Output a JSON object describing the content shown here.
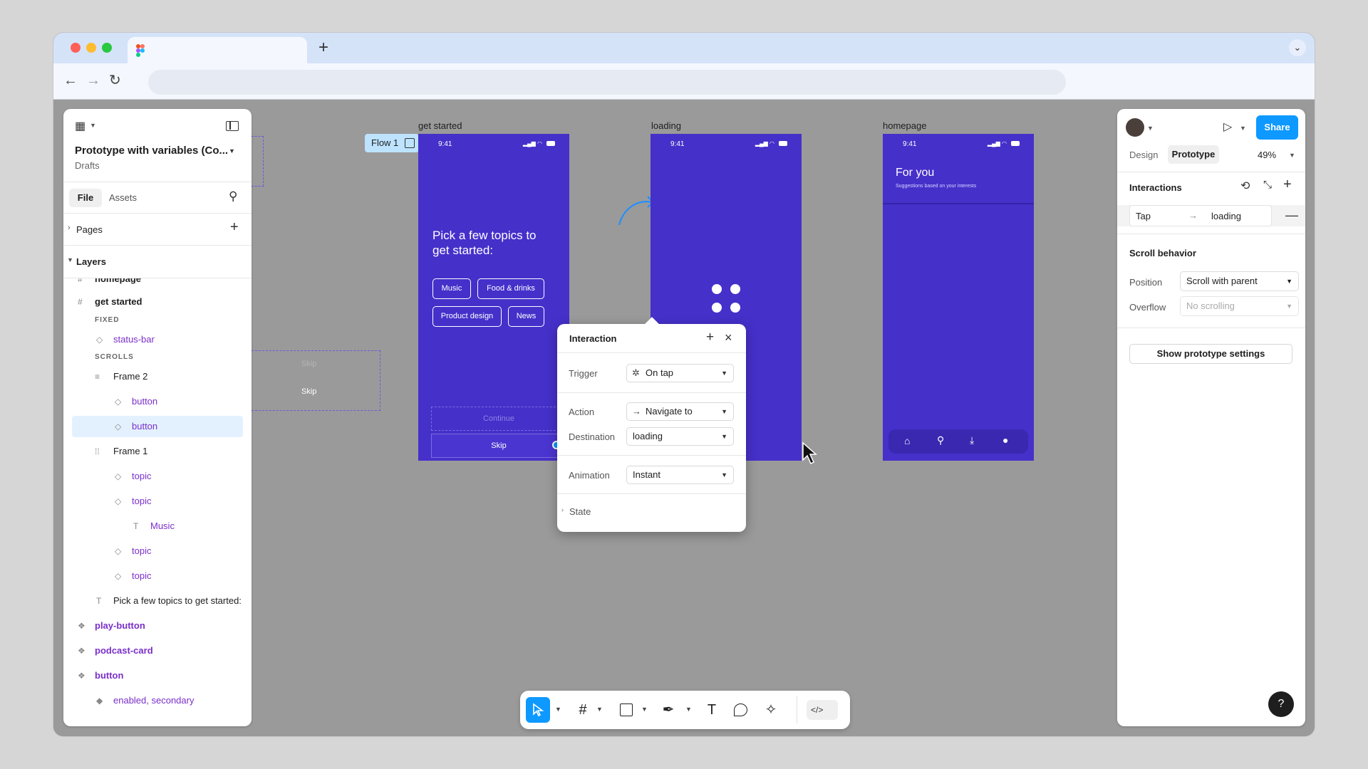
{
  "browser": {
    "new_tab": "+",
    "tab_menu": "⌄"
  },
  "left_panel": {
    "file_title": "Prototype with variables (Co...",
    "subtitle": "Drafts",
    "tabs": {
      "file": "File",
      "assets": "Assets"
    },
    "pages_label": "Pages",
    "layers_label": "Layers",
    "layers": [
      {
        "label": "homepage"
      },
      {
        "label": "get started"
      },
      {
        "label": "FIXED"
      },
      {
        "label": "status-bar"
      },
      {
        "label": "SCROLLS"
      },
      {
        "label": "Frame 2"
      },
      {
        "label": "button"
      },
      {
        "label": "button"
      },
      {
        "label": "Frame 1"
      },
      {
        "label": "topic"
      },
      {
        "label": "topic"
      },
      {
        "label": "Music"
      },
      {
        "label": "topic"
      },
      {
        "label": "topic"
      },
      {
        "label": "Pick a few topics to get started:"
      },
      {
        "label": "play-button"
      },
      {
        "label": "podcast-card"
      },
      {
        "label": "button"
      },
      {
        "label": "enabled, secondary"
      }
    ]
  },
  "canvas": {
    "flow_label": "Flow 1",
    "ghost_skip_1": "Skip",
    "ghost_skip_2": "Skip",
    "frames": {
      "get_started": {
        "name": "get started",
        "time": "9:41",
        "headline": "Pick a few topics to get started:",
        "topics": [
          "Music",
          "Food & drinks",
          "Product design",
          "News"
        ],
        "continue": "Continue",
        "skip": "Skip"
      },
      "loading": {
        "name": "loading",
        "time": "9:41"
      },
      "homepage": {
        "name": "homepage",
        "time": "9:41",
        "title": "For you",
        "subtitle": "Suggestions based on your interests"
      }
    }
  },
  "interaction_modal": {
    "title": "Interaction",
    "trigger_label": "Trigger",
    "trigger_value": "On tap",
    "action_label": "Action",
    "action_value": "Navigate to",
    "destination_label": "Destination",
    "destination_value": "loading",
    "animation_label": "Animation",
    "animation_value": "Instant",
    "state_label": "State"
  },
  "right_panel": {
    "share": "Share",
    "tab_design": "Design",
    "tab_prototype": "Prototype",
    "zoom": "49%",
    "interactions_label": "Interactions",
    "interaction_trigger": "Tap",
    "interaction_target": "loading",
    "scroll_behavior_label": "Scroll behavior",
    "position_label": "Position",
    "position_value": "Scroll with parent",
    "overflow_label": "Overflow",
    "overflow_value": "No scrolling",
    "prototype_settings": "Show prototype settings",
    "help": "?"
  },
  "colors": {
    "frame_bg": "#4530ca",
    "accent": "#0d99ff",
    "component": "#7a2fc9"
  }
}
